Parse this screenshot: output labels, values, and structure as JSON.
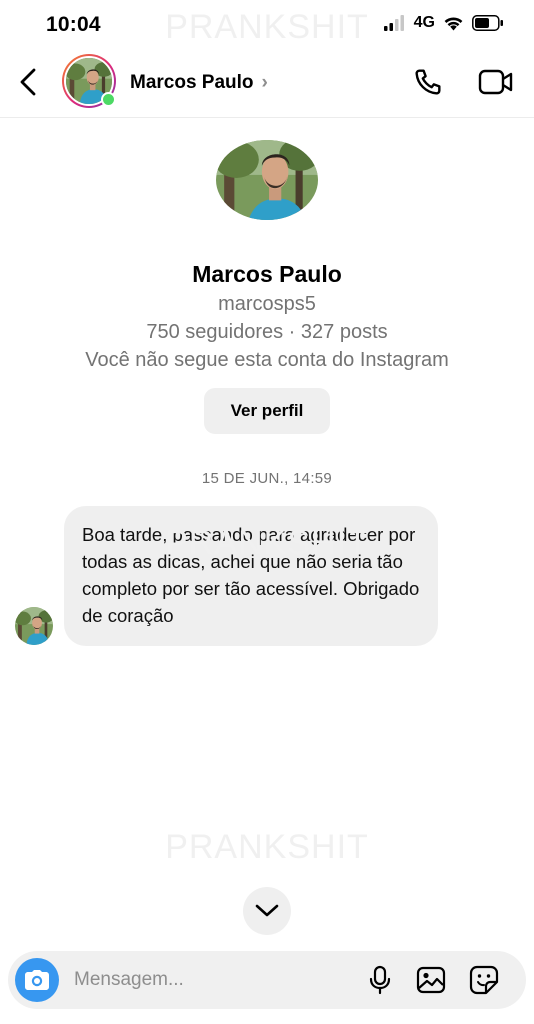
{
  "status_bar": {
    "time": "10:04",
    "network": "4G"
  },
  "watermark": "PRANKSHIT",
  "header": {
    "contact_name": "Marcos Paulo",
    "chevron": "›",
    "icons": [
      "back-arrow-icon",
      "phone-icon",
      "video-camera-icon"
    ],
    "online": true
  },
  "profile": {
    "name": "Marcos Paulo",
    "username": "marcosps5",
    "stats": "750 seguidores · 327 posts",
    "follow_status": "Você não segue esta conta do Instagram",
    "view_profile_label": "Ver perfil"
  },
  "conversation": {
    "timestamp": "15 DE JUN., 14:59",
    "messages": [
      {
        "from": "contact",
        "text": "Boa tarde, passando para agradecer por todas as dicas, achei que não seria tão completo por ser tão acessível. Obrigado de coração"
      }
    ]
  },
  "composer": {
    "placeholder": "Mensagem...",
    "icons": [
      "camera-icon",
      "microphone-icon",
      "gallery-icon",
      "sticker-icon"
    ]
  },
  "colors": {
    "accent": "#3797f0",
    "online": "#4cd964",
    "bubble": "#efefef",
    "secondary_text": "#737373"
  }
}
